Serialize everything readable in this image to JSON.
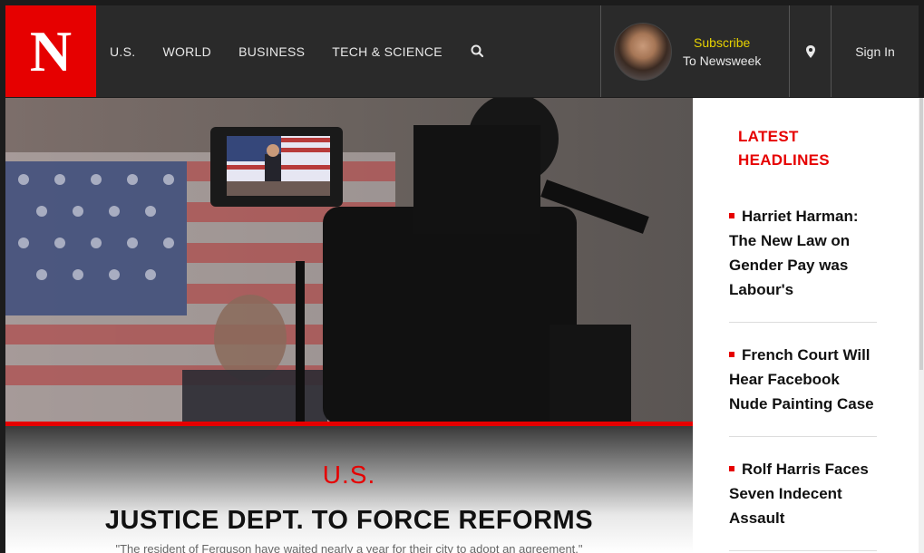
{
  "header": {
    "logo_text": "N",
    "nav": [
      "U.S.",
      "WORLD",
      "BUSINESS",
      "TECH & SCIENCE"
    ],
    "subscribe_line1": "Subscribe",
    "subscribe_line2": "To Newsweek",
    "signin": "Sign In",
    "icons": [
      "search-icon",
      "location-pin-icon"
    ]
  },
  "hero": {
    "section": "U.S.",
    "title": "JUSTICE DEPT. TO FORCE REFORMS",
    "subtitle": "\"The resident of Ferguson have waited nearly a year for their city to adopt an agreement.\""
  },
  "sidebar": {
    "heading_line1": "LATEST",
    "heading_line2": "HEADLINES",
    "headlines": [
      "Harriet Harman: The New Law on Gender Pay was Labour's",
      "French Court Will Hear Facebook Nude Painting Case",
      "Rolf Harris Faces Seven Indecent Assault"
    ]
  },
  "colors": {
    "brand_red": "#e60000",
    "subscribe_yellow": "#e6d200",
    "topbar": "#2a2a2a"
  }
}
